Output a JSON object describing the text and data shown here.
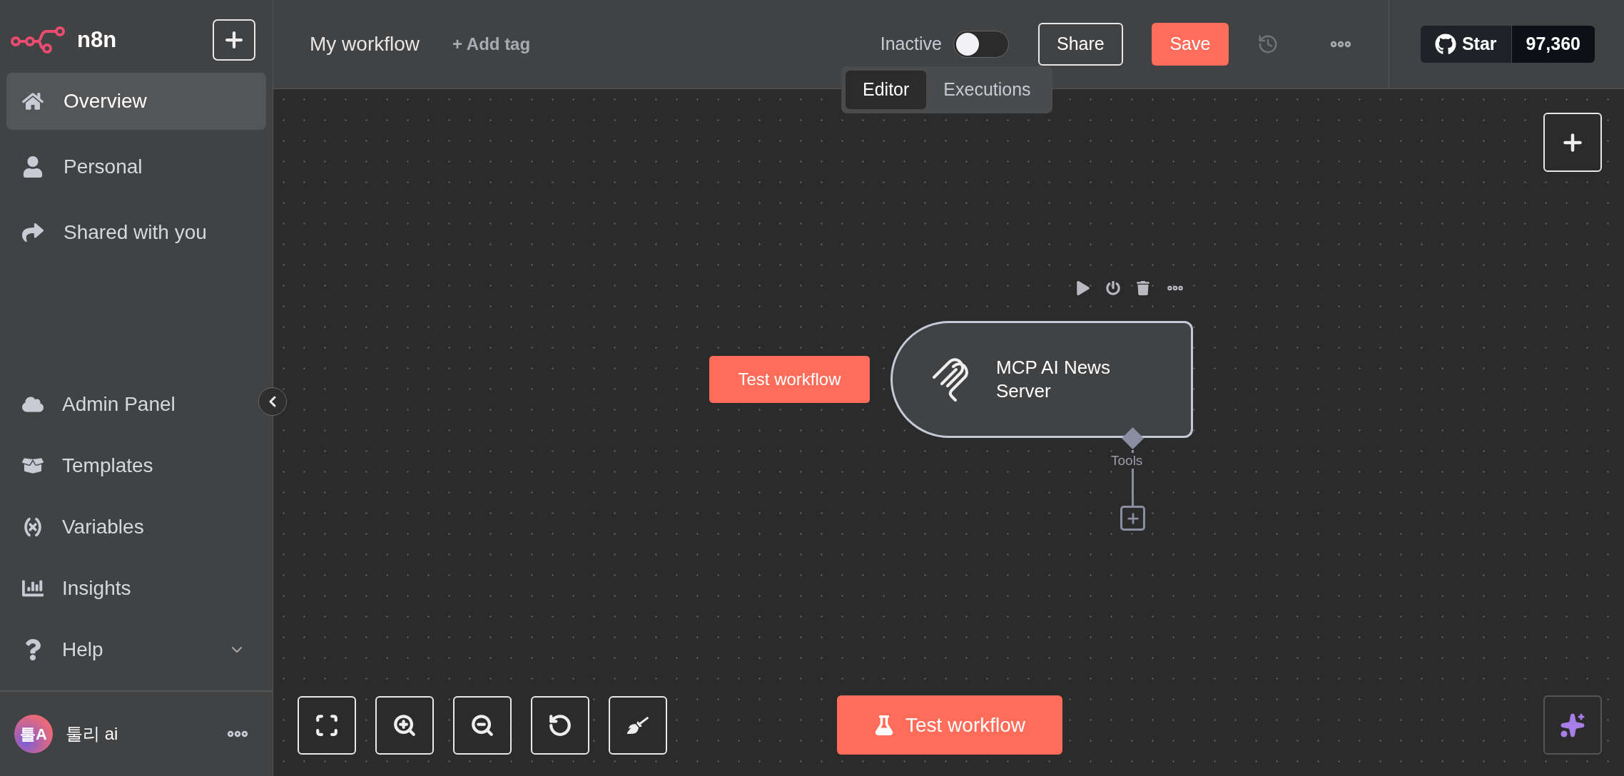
{
  "app": {
    "logo_text": "n8n"
  },
  "sidebar": {
    "items": [
      {
        "label": "Overview",
        "selected": true
      },
      {
        "label": "Personal",
        "selected": false
      },
      {
        "label": "Shared with you",
        "selected": false
      }
    ],
    "bottom_items": [
      {
        "label": "Admin Panel",
        "expandable": false
      },
      {
        "label": "Templates",
        "expandable": false
      },
      {
        "label": "Variables",
        "expandable": false
      },
      {
        "label": "Insights",
        "expandable": false
      },
      {
        "label": "Help",
        "expandable": true
      }
    ],
    "user": {
      "avatar_text": "툴A",
      "name": "툴리 ai"
    }
  },
  "header": {
    "title": "My workflow",
    "add_tag": "+ Add tag",
    "active_label": "Inactive",
    "active": false,
    "share": "Share",
    "save": "Save",
    "github": {
      "label": "Star",
      "count": "97,360"
    }
  },
  "view_tabs": [
    {
      "label": "Editor",
      "selected": true
    },
    {
      "label": "Executions",
      "selected": false
    }
  ],
  "canvas": {
    "trigger_button": "Test workflow",
    "node": {
      "title": "MCP AI News Server",
      "output_label": "Tools"
    },
    "run_button": "Test workflow"
  }
}
